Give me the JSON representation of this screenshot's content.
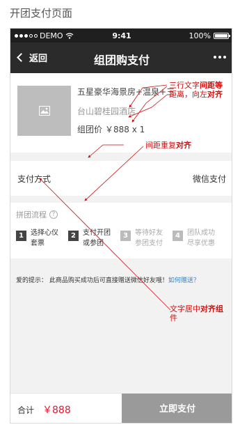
{
  "page_heading": "开团支付页面",
  "status_bar": {
    "carrier": "DEMO",
    "time": "9:41",
    "battery": "100%"
  },
  "nav": {
    "back_label": "返回",
    "title": "组团购支付"
  },
  "product": {
    "name": "五星豪华海景房+温泉+三",
    "hotel": "台山碧桂园酒店",
    "price_label": "组团价",
    "price_value": "￥888 x 1"
  },
  "payment": {
    "label": "支付方式",
    "value": "微信支付"
  },
  "flow": {
    "title": "拼团流程",
    "help": "?",
    "steps": [
      {
        "num": "1",
        "line1": "选择心仪",
        "line2": "套票"
      },
      {
        "num": "2",
        "line1": "支付开团",
        "line2": "或参团"
      },
      {
        "num": "3",
        "line1": "等待好友",
        "line2": "参团支付"
      },
      {
        "num": "4",
        "line1": "团队成功",
        "line2": "尽享优惠"
      }
    ]
  },
  "tip": {
    "text": "爱的提示： 此商品购买成功后可直接赠送微信好友哦！",
    "link": "如何赠送？"
  },
  "footer": {
    "total_label": "合计",
    "total_value": "￥888",
    "pay_button": "立即支付"
  },
  "annotations": {
    "a1_line1_pre": "三行文字",
    "a1_line1_bold": "间距等",
    "a1_line2_pre": "距离，向左",
    "a1_line2_bold": "对齐",
    "a2_pre": "间距重复",
    "a2_bold": "对齐",
    "a3_line1_pre": "文字居中",
    "a3_line1_bold": "对齐组",
    "a3_line2": "件"
  },
  "colors": {
    "annotation": "#cc1111",
    "price": "#e5162f",
    "link": "#3b82c4",
    "nav_bg": "#2b2b2b",
    "pay_button": "#9a9a9a"
  }
}
